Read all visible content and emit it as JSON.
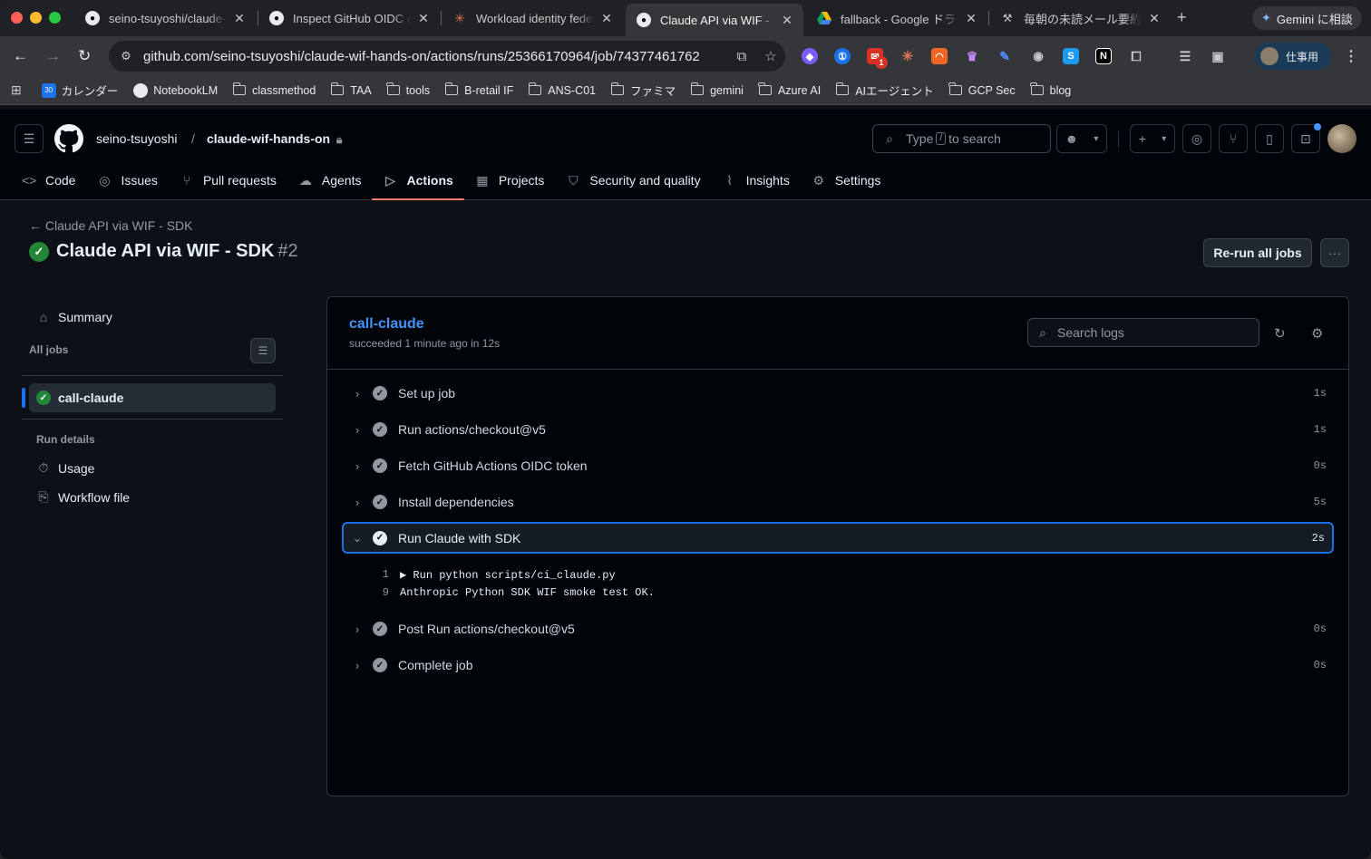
{
  "browser": {
    "tabs": [
      {
        "title": "seino-tsuyoshi/claude-",
        "icon": "github-icon"
      },
      {
        "title": "Inspect GitHub OIDC cl",
        "icon": "github-icon"
      },
      {
        "title": "Workload identity feder",
        "icon": "claude-icon"
      },
      {
        "title": "Claude API via WIF - SI",
        "icon": "github-icon",
        "active": true
      },
      {
        "title": "fallback - Google ドライ",
        "icon": "google-drive-icon"
      },
      {
        "title": "毎朝の未読メール要約通知",
        "icon": "tool-icon"
      }
    ],
    "gemini_label": "Gemini に相談",
    "url": "github.com/seino-tsuyoshi/claude-wif-hands-on/actions/runs/25366170964/job/74377461762",
    "extension_badge": "1",
    "profile_label": "仕事用",
    "bookmarks": [
      "カレンダー",
      "NotebookLM",
      "classmethod",
      "TAA",
      "tools",
      "B-retail IF",
      "ANS-C01",
      "ファミマ",
      "gemini",
      "Azure AI",
      "AIエージェント",
      "GCP Sec",
      "blog"
    ],
    "calendar_badge": "30"
  },
  "github": {
    "owner": "seino-tsuyoshi",
    "separator": "/",
    "repo": "claude-wif-hands-on",
    "search_prefix": "Type",
    "search_key": "/",
    "search_suffix": "to search",
    "nav": [
      {
        "label": "Code",
        "icon": "code-icon"
      },
      {
        "label": "Issues",
        "icon": "issue-icon"
      },
      {
        "label": "Pull requests",
        "icon": "pull-request-icon"
      },
      {
        "label": "Agents",
        "icon": "agents-icon"
      },
      {
        "label": "Actions",
        "icon": "play-icon",
        "selected": true
      },
      {
        "label": "Projects",
        "icon": "table-icon"
      },
      {
        "label": "Security and quality",
        "icon": "shield-icon"
      },
      {
        "label": "Insights",
        "icon": "graph-icon"
      },
      {
        "label": "Settings",
        "icon": "gear-icon"
      }
    ]
  },
  "run": {
    "back_label": "Claude API via WIF - SDK",
    "title": "Claude API via WIF - SDK",
    "number": "#2",
    "rerun_label": "Re-run all jobs"
  },
  "sidebar": {
    "summary": "Summary",
    "all_jobs": "All jobs",
    "job": "call-claude",
    "run_details": "Run details",
    "usage": "Usage",
    "workflow_file": "Workflow file"
  },
  "job": {
    "name": "call-claude",
    "meta": "succeeded 1 minute ago in 12s",
    "search_placeholder": "Search logs",
    "steps": [
      {
        "name": "Set up job",
        "duration": "1s"
      },
      {
        "name": "Run actions/checkout@v5",
        "duration": "1s"
      },
      {
        "name": "Fetch GitHub Actions OIDC token",
        "duration": "0s"
      },
      {
        "name": "Install dependencies",
        "duration": "5s"
      },
      {
        "name": "Run Claude with SDK",
        "duration": "2s",
        "expanded": true
      },
      {
        "name": "Post Run actions/checkout@v5",
        "duration": "0s"
      },
      {
        "name": "Complete job",
        "duration": "0s"
      }
    ],
    "log_lines": [
      {
        "num": "1",
        "text": "▶ Run python scripts/ci_claude.py"
      },
      {
        "num": "9",
        "text": "Anthropic Python SDK WIF smoke test OK."
      }
    ]
  },
  "colors": {
    "accent_blue": "#4493f8",
    "success_green": "#238636",
    "nav_underline": "#f78166",
    "focus_border": "#1f6feb"
  }
}
